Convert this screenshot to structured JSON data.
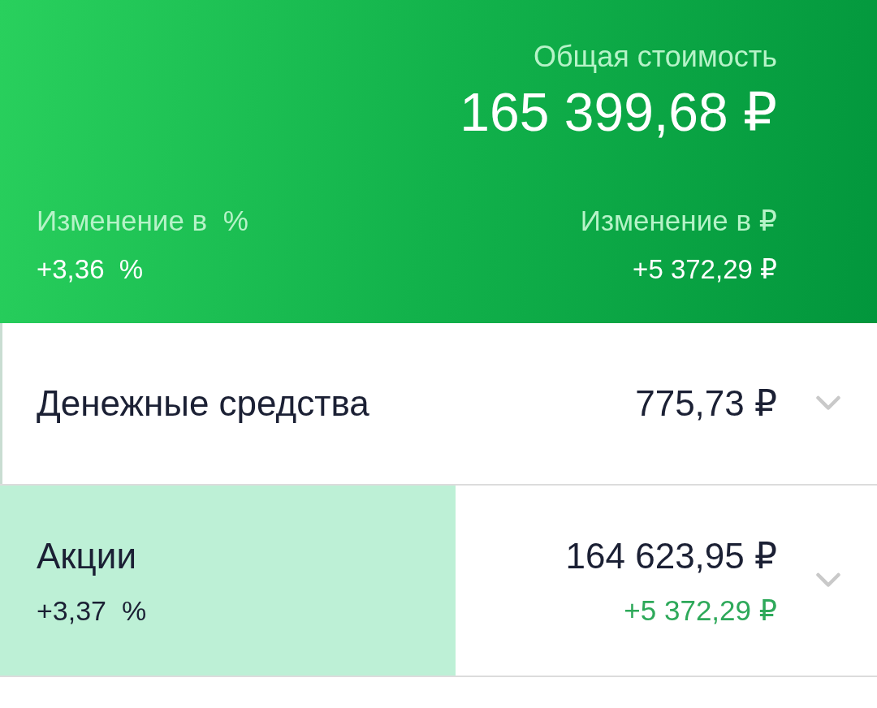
{
  "header": {
    "total_label": "Общая стоимость",
    "total_value": "165 399,68 ₽",
    "change_percent": {
      "label": "Изменение в  %",
      "value": "+3,36  %"
    },
    "change_rub": {
      "label": "Изменение в ₽",
      "value": "+5 372,29 ₽"
    }
  },
  "assets": [
    {
      "name": "Денежные средства",
      "value": "775,73 ₽",
      "level": 0.003,
      "color": "#c9ddd2",
      "expanded": false
    },
    {
      "name": "Акции",
      "change_percent": "+3,37  %",
      "value": "164 623,95 ₽",
      "change_value": "+5 372,29 ₽",
      "level": 0.519,
      "color": "#bdf0d6",
      "expanded": false
    }
  ]
}
